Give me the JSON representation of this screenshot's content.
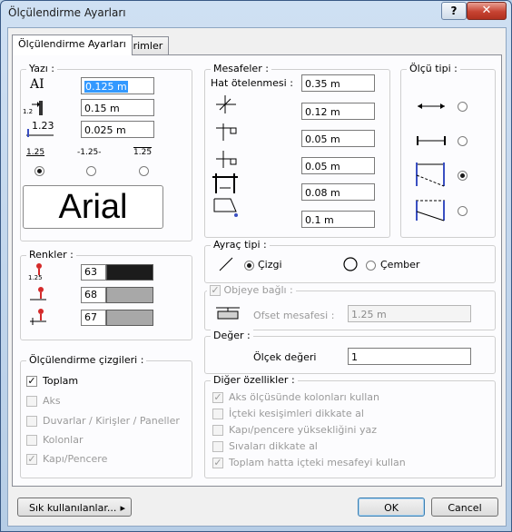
{
  "window": {
    "title": "Ölçülendirme Ayarları",
    "help_label": "?",
    "close_label": "✕"
  },
  "tabs": [
    {
      "label": "Ölçülendirme Ayarları"
    },
    {
      "label": "Birimler"
    }
  ],
  "yazi": {
    "title": "Yazı :",
    "fields": [
      {
        "value": "0.125 m"
      },
      {
        "value": "0.15 m"
      },
      {
        "value": "0.025 m"
      }
    ],
    "icon_labels": {
      "height": "AI",
      "spacing": "1.2",
      "offset": "1.23"
    },
    "position_labels": [
      "1.25",
      "-1.25-",
      "1.25"
    ],
    "selected_position": 0,
    "font_name": "Arial"
  },
  "renkler": {
    "title": "Renkler :",
    "items": [
      {
        "value": "63",
        "color": "#1c1c1c"
      },
      {
        "value": "68",
        "color": "#a8a8a8"
      },
      {
        "value": "67",
        "color": "#a8a8a8"
      }
    ],
    "icon_label": "1.25"
  },
  "cizgiler": {
    "title": "Ölçülendirme çizgileri :",
    "items": [
      {
        "label": "Toplam",
        "checked": true,
        "enabled": true
      },
      {
        "label": "Aks",
        "checked": false,
        "enabled": false
      },
      {
        "label": "Duvarlar / Kirişler / Paneller",
        "checked": false,
        "enabled": false
      },
      {
        "label": "Kolonlar",
        "checked": false,
        "enabled": false
      },
      {
        "label": "Kapı/Pencere",
        "checked": true,
        "enabled": false
      }
    ]
  },
  "mesafeler": {
    "title": "Mesafeler :",
    "hat_label": "Hat ötelenmesi :",
    "hat_value": "0.35 m",
    "fields": [
      {
        "value": "0.12 m"
      },
      {
        "value": "0.05 m"
      },
      {
        "value": "0.05 m"
      },
      {
        "value": "0.08 m"
      },
      {
        "value": "0.1 m"
      }
    ]
  },
  "olcu_tipi": {
    "title": "Ölçü tipi :",
    "selected": 2
  },
  "ayrac": {
    "title": "Ayraç tipi :",
    "options": [
      {
        "label": "Çizgi"
      },
      {
        "label": "Çember"
      }
    ],
    "selected": 0
  },
  "objeye": {
    "title": "Objeye bağlı :",
    "ofset_label": "Ofset mesafesi :",
    "ofset_value": "1.25 m"
  },
  "deger": {
    "title": "Değer :",
    "label": "Ölçek değeri",
    "value": "1"
  },
  "diger": {
    "title": "Diğer özellikler :",
    "items": [
      {
        "label": "Aks ölçüsünde kolonları kullan",
        "checked": true
      },
      {
        "label": "İçteki kesişimleri dikkate al",
        "checked": false
      },
      {
        "label": "Kapı/pencere yüksekliğini yaz",
        "checked": false
      },
      {
        "label": "Sıvaları dikkate al",
        "checked": false
      },
      {
        "label": "Toplam hatta içteki mesafeyi kullan",
        "checked": true
      }
    ]
  },
  "footer": {
    "favorites_label": "Sık kullanılanlar...",
    "arrow": "▸",
    "ok_label": "OK",
    "cancel_label": "Cancel"
  }
}
